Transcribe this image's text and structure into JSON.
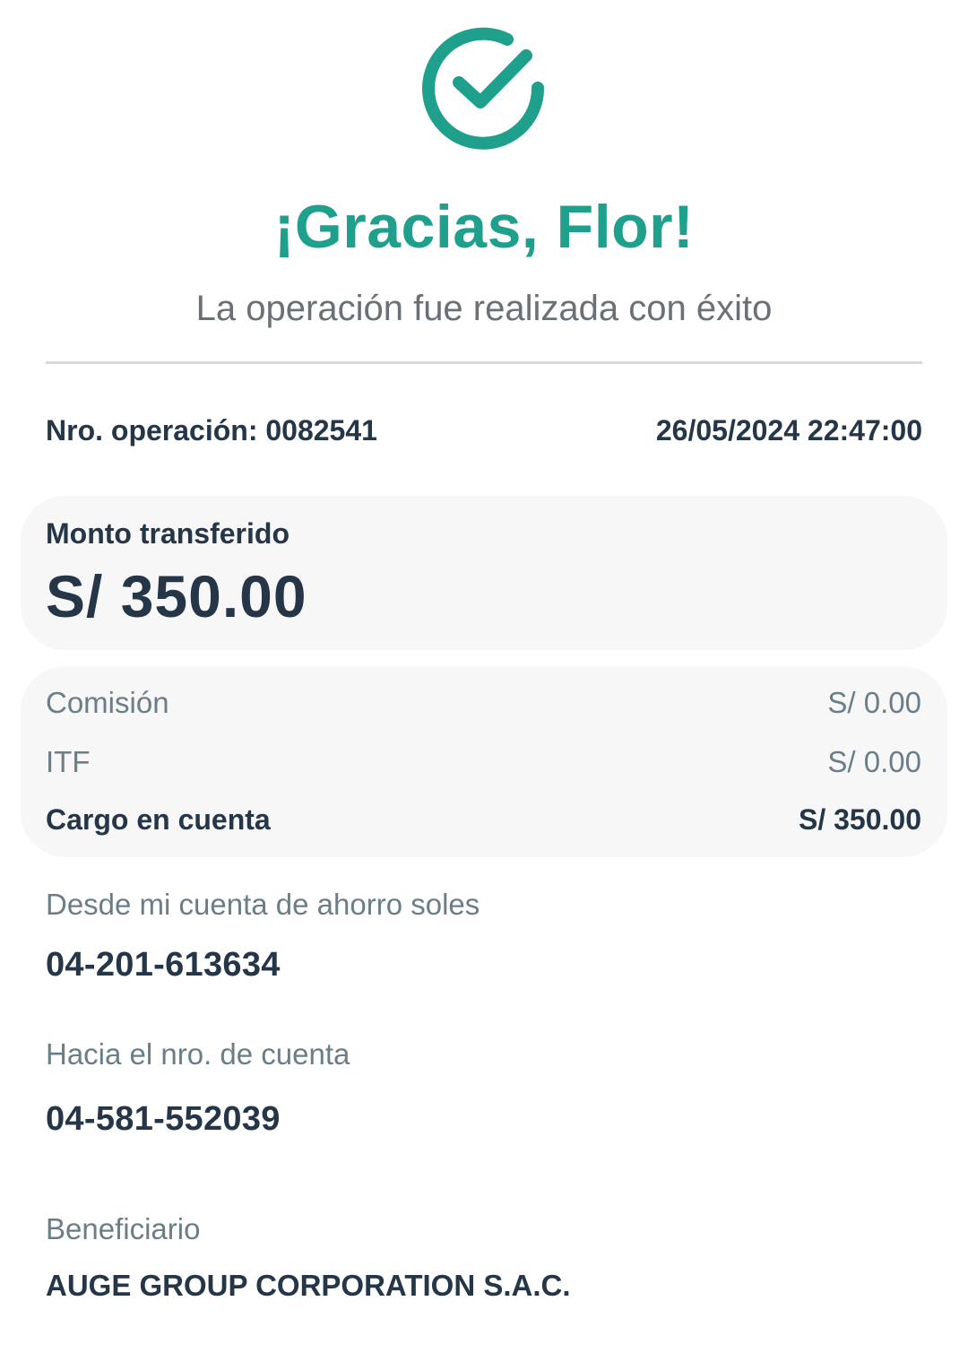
{
  "header": {
    "icon": "check-circle-icon",
    "title": "¡Gracias, Flor!",
    "subtitle": "La operación fue realizada con éxito"
  },
  "meta": {
    "operation_number": "Nro. operación: 0082541",
    "datetime": "26/05/2024 22:47:00"
  },
  "amount": {
    "label": "Monto transferido",
    "value": "S/ 350.00"
  },
  "fees": {
    "commission_label": "Comisión",
    "commission_value": "S/ 0.00",
    "itf_label": "ITF",
    "itf_value": "S/ 0.00",
    "charge_label": "Cargo en cuenta",
    "charge_value": "S/ 350.00"
  },
  "from": {
    "label": "Desde mi cuenta de ahorro soles",
    "account": "04-201-613634"
  },
  "to": {
    "label": "Hacia el nro. de cuenta",
    "account": "04-581-552039"
  },
  "beneficiary": {
    "label": "Beneficiario",
    "name": "AUGE GROUP CORPORATION S.A.C."
  },
  "colors": {
    "accent": "#1ea08d",
    "text_dark": "#243648",
    "text_muted": "#6b7e88",
    "card_bg": "#f7f7f7"
  }
}
